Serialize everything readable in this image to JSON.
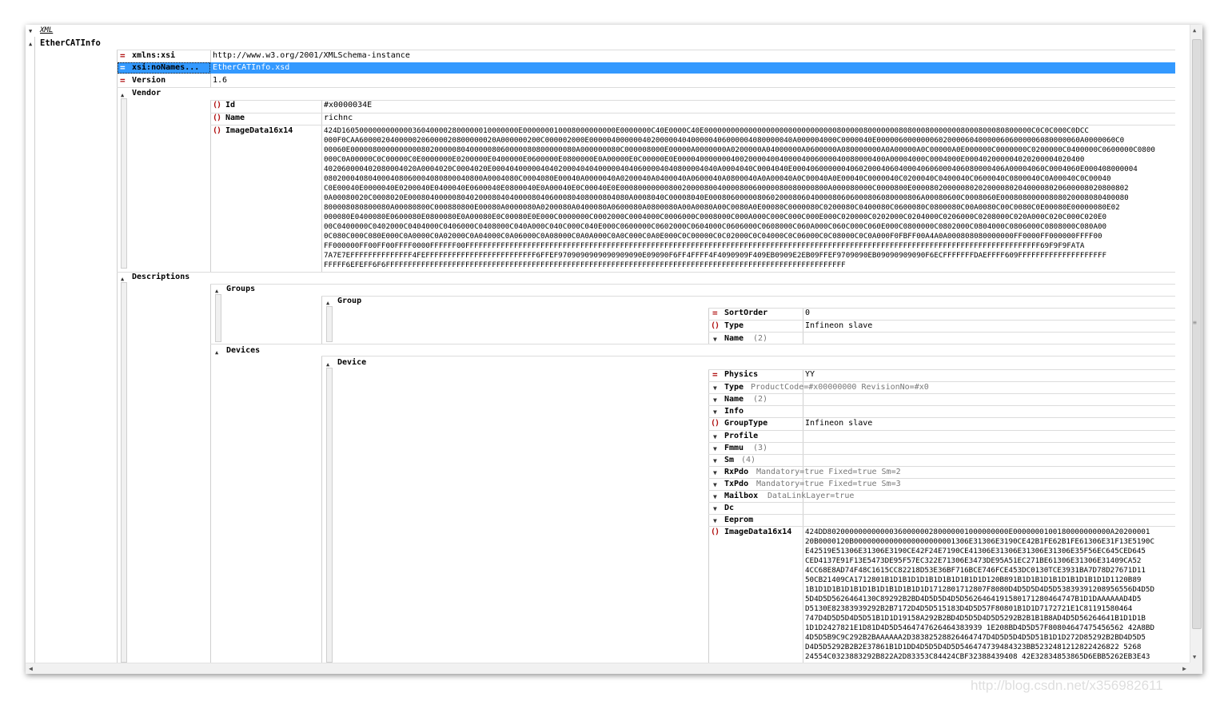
{
  "root": {
    "label": "XML"
  },
  "ethercat": {
    "label": "EtherCATInfo",
    "xmlns": {
      "name": "xmlns:xsi",
      "value": "http://www.w3.org/2001/XMLSchema-instance"
    },
    "nons": {
      "name": "xsi:noNames...",
      "value": "EtherCATInfo.xsd"
    },
    "version": {
      "name": "Version",
      "value": "1.6"
    },
    "vendor": {
      "label": "Vendor",
      "id": {
        "name": "Id",
        "value": "#x0000034E"
      },
      "name": {
        "name": "Name",
        "value": "richnc"
      },
      "image": {
        "name": "ImageData16x14",
        "lines": [
          "424D1605000000000000360400002800000010000000E000000010008000000000E0000000C40E0000C40E00000000000000000000000000000080000080000000808000800000008000800080800000C0C0C000C0DCC",
          "000F0CAA6000020400000206000020800000020A000000200C000002000E0000040000004020000040400000406000004080000040A000004000C0000040E0000060000000602000060400000606000006080000060A0000060C0",
          "00060E000008000000000080200000804000008060000080800000080A000000080C000008000E00000A0000000A0200000A04000000A0600000A080000000A0A00000A0C00000A0E000000C0000000C0200000C0400000C0600000C0800",
          "000C0A00000C0C00000C0E0000000E0200000E0400000E0600000E0800000E0A00000E0C00000E0E00004000000040020000400400004006000040080000400A00004000C0004000E000402000004020200004020400",
          "402060000402080004020A0004020C0004020E000404000004040200040404000004040600004040800004040A0004040C0004040E000406000000406020004060400040606000406080000406A00004060C0004060E000408000004",
          "080200040804000408060004080800040800A0004080C0004080E00040A0000040A0200040A0400040A0600040A0800040A0A00040A0C00040A0E00040C0000040C0200040C0400040C0600040C0800040C0A00040C0C00040",
          "C0E00040E0000040E0200040E0400040E0600040E0800040E0A00040E0C00040E0E00080000000800200008004000080060000080080000800A000080000C0000800E0000802000008020200008020400008020600008020800802",
          "0A00080020C0008020E00080400000804020008040400008040600080408000804080A0008040C00008040E000806000008060200080604000080606000806080000806A00080600C0008060E00080800000808020008080400080",
          "800008080800080A00080800C000880800E00080A0000080A0200080A0400080A0600080A0800080A00A0080A00C0080A0E00080C0000080C0200080C0400080C0600080C0800080C00A0080C00C0080C0E00080E00000080E02",
          "000080E0400080E0600080E0800080E0A00080E0C00080E0E000C0000000C0002000C0004000C0006000C0008000C000A000C000C000C000E000C020000C0202000C0204000C0206000C0208000C020A000C020C000C020E0",
          "00C0400000C0402000C0404000C0406000C0408000C040A000C040C000C040E000C0600000C0602000C0604000C0606000C0608000C060A000C060C000C060E000C0800000C0802000C0804000C0806000C0808000C080A00",
          "0C080C000C080E000C0A0000C0A02000C0A04000C0A06000C0A08000C0A0A000C0A0C000C0A0E000C0C00000C0C02000C0C04000C0C06000C0C08000C0C0A000F0FBFF00A4A0A000808080000000FF0000FF000000FFFF00",
          "FF000000FF00FF00FFFF0000FFFFFF00FFFFFFFFFFFFFFFFFFFFFFFFFFFFFFFFFFFFFFFFFFFFFFFFFFFFFFFFFFFFFFFFFFFFFFFFFFFFFFFFFFFFFFFFFFFFFFFFFFFFFFFFFFFFFFFFFFFFFFFFFFFFFFFFFF69F9F9FATA",
          "7A7E7EFFFFFFFFFFFFFF4FEFFFFFFFFFFFFFFFFFFFFFFFFF6FFEF9709090909090909090E09090F6FF4FFFF4F4090909F409EB0909E2EB09FFEF9709090EB09090909090F6ECFFFFFFFDAEFFFF609FFFFFFFFFFFFFFFFFFFF",
          "FFFFF6EFEFF6F6FFFFFFFFFFFFFFFFFFFFFFFFFFFFFFFFFFFFFFFFFFFFFFFFFFFFFFFFFFFFFFFFFFFFFFFFFFFFFFFFFFFFFFFFFFFFFFFFFFFFFFFF"
        ]
      }
    },
    "descriptions": {
      "label": "Descriptions",
      "groups": {
        "label": "Groups",
        "group": {
          "label": "Group",
          "sortorder": {
            "name": "SortOrder",
            "value": "0"
          },
          "type": {
            "name": "Type",
            "value": "Infineon slave"
          },
          "name": {
            "name": "Name",
            "count": "(2)"
          }
        }
      },
      "devices": {
        "label": "Devices",
        "device": {
          "label": "Device",
          "physics": {
            "name": "Physics",
            "value": "YY"
          },
          "type": {
            "name": "Type",
            "attrs": "ProductCode=#x00000000 RevisionNo=#x0"
          },
          "name": {
            "name": "Name",
            "count": "(2)"
          },
          "info": {
            "name": "Info"
          },
          "grouptype": {
            "name": "GroupType",
            "value": "Infineon slave"
          },
          "profile": {
            "name": "Profile"
          },
          "fmmu": {
            "name": "Fmmu",
            "count": "(3)"
          },
          "sm": {
            "name": "Sm",
            "count": "(4)"
          },
          "rxpdo": {
            "name": "RxPdo",
            "attrs": "Mandatory=true Fixed=true Sm=2"
          },
          "txpdo": {
            "name": "TxPdo",
            "attrs": "Mandatory=true Fixed=true Sm=3"
          },
          "mailbox": {
            "name": "Mailbox",
            "attrs": "DataLinkLayer=true"
          },
          "dc": {
            "name": "Dc"
          },
          "eeprom": {
            "name": "Eeprom"
          },
          "image": {
            "name": "ImageData16x14",
            "lines": [
              "424DD80200000000000036000000280000001000000000E0000000100180000000000A20200001",
              "20B0000120B00000000000000000000001306E31306E3190CE42B1FE62B1FE61306E31F13E5190C",
              "E42519E51306E31306E3190CE42F24E7190CE41306E31306E31306E31306E35F56EC645CED645",
              "CED4137E91F13E5473DE95F57EC322E71306E3473DE95A51EC271BE61306E31306E31409CA52",
              "4CC68E8AD74F48C1615CC82218D53E36BF716BCE746FCE453DC0130TCE3931BA7D78D27671D11",
              "50CB21409CA1712801B1D1B1D1D1B1D1B1D1B1D1D120B891B1D1B1D1B1D1B1D1B1D1D1120B89",
              "1B1D1D1B1D1B1D1B1D1B1D1B1D1D1712801712807F8080D4D5D5D4D5D53839391208956556D4D5D",
              "5D4D5D5626464130C89292B2BD4D5D5D4D5D5626464191580171280464747B1D1DAAAAAAD4D5",
              "D5130E82383939292B2B7172D4D5D515183D4D5D57F80801B1D1D7172721E1C81191580464",
              "747D4D5D5D4D5D51B1D1D19158A292B2BD4D5D5D4D5D5292B2B1B1B8AD4D5D56264641B1D1D1B",
              "1D1D2427821E1D81D4D5D5464747626464383939 1E208BD4D5D57F80804647475456562 42A8BD",
              "4D5D5B9C9C292B2BAAAAAA2D38382528826464747D4D5D5D4D5D51B1D1D272D85292B2BD4D5D5",
              "D4D5D5292B2B2E37861B1D1DD4D5D5D4D5D546474739484323BB5232481212822426822 5268",
              "24554C0323883292B822A2D83353C84424CBF32388439408 42E32834853865D6EBB5262EB3E43"
            ]
          }
        }
      }
    }
  },
  "watermark": "http://blog.csdn.net/x356982611"
}
